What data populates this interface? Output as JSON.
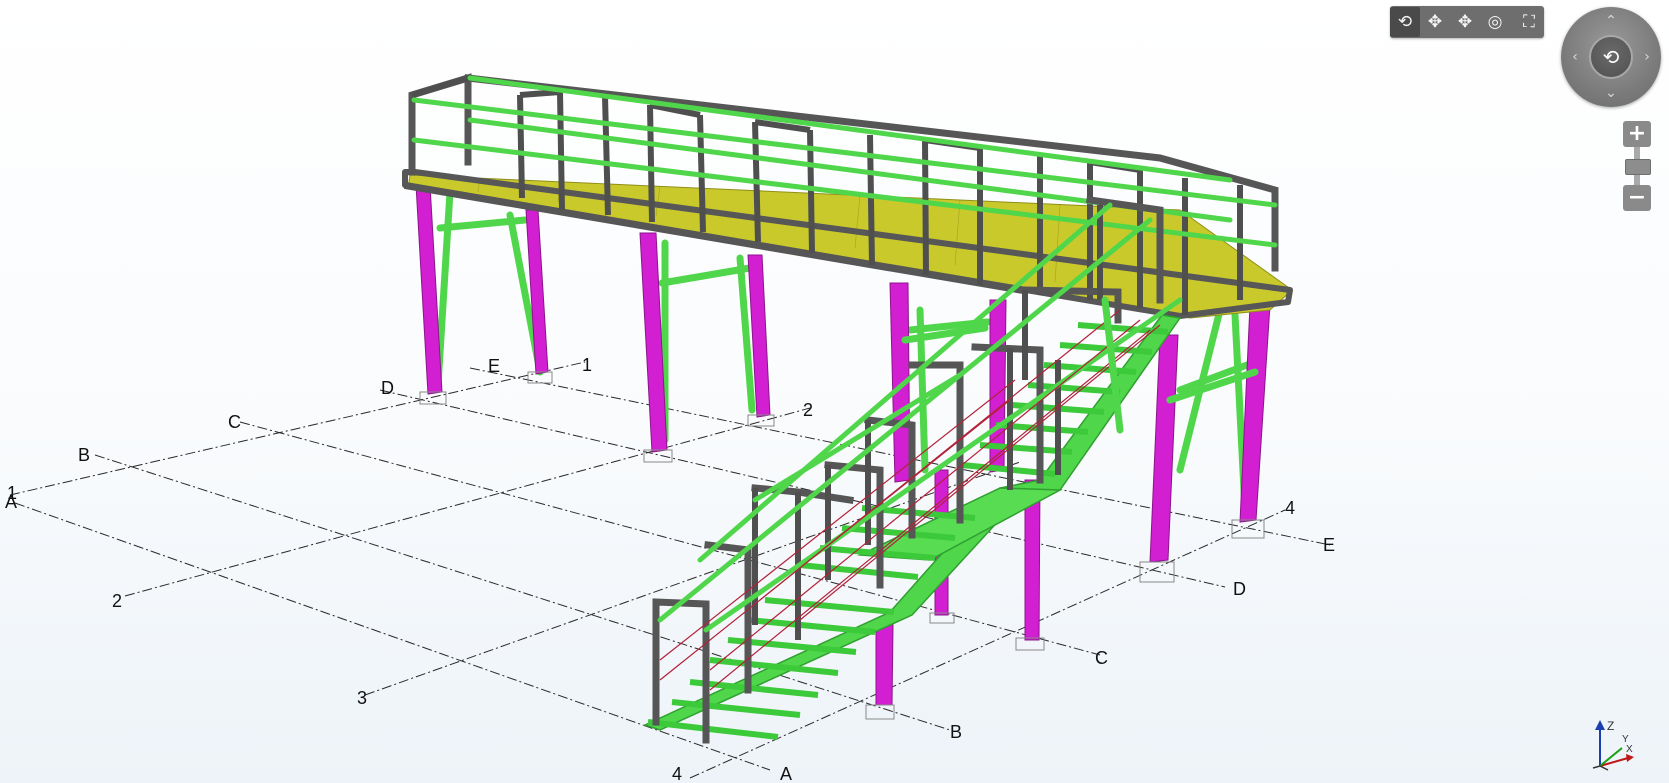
{
  "viewer": {
    "toolbar": {
      "orbit_icon": "orbit-icon",
      "pan_icon": "pan-icon",
      "move_icon": "move-icon",
      "look_icon": "look-around-icon",
      "fullscreen_icon": "fullscreen-icon"
    },
    "navcube": {
      "up": "up-arrow-icon",
      "down": "down-arrow-icon",
      "left": "left-arrow-icon",
      "right": "right-arrow-icon",
      "center": "orbit-icon"
    },
    "zoom": {
      "in_label": "+",
      "out_label": "−"
    }
  },
  "grid": {
    "lettered_axes": [
      "A",
      "B",
      "C",
      "D",
      "E"
    ],
    "numbered_axes": [
      "1",
      "2",
      "3",
      "4"
    ],
    "labels": {
      "far_E": "E",
      "far_D": "D",
      "far_C": "C",
      "far_B": "B",
      "far_A": "A",
      "top_1": "1",
      "top_2": "2",
      "right_4": "4",
      "right_E": "E",
      "right_D": "D",
      "right_C": "C",
      "right_B": "B",
      "bottom_A": "A",
      "left_2": "2",
      "left_3": "3",
      "bottom_4": "4",
      "left_1": "1"
    }
  },
  "axis_gizmo": {
    "z": "Z",
    "y": "Y",
    "x": "X"
  },
  "colors": {
    "columns": "#d21fd2",
    "bracing_and_rails": "#4fd64a",
    "steel_frame": "#565656",
    "deck_grating": "#c9c92c",
    "cables": "#b2223a",
    "toolbar_bg": "#6e6e6e"
  }
}
